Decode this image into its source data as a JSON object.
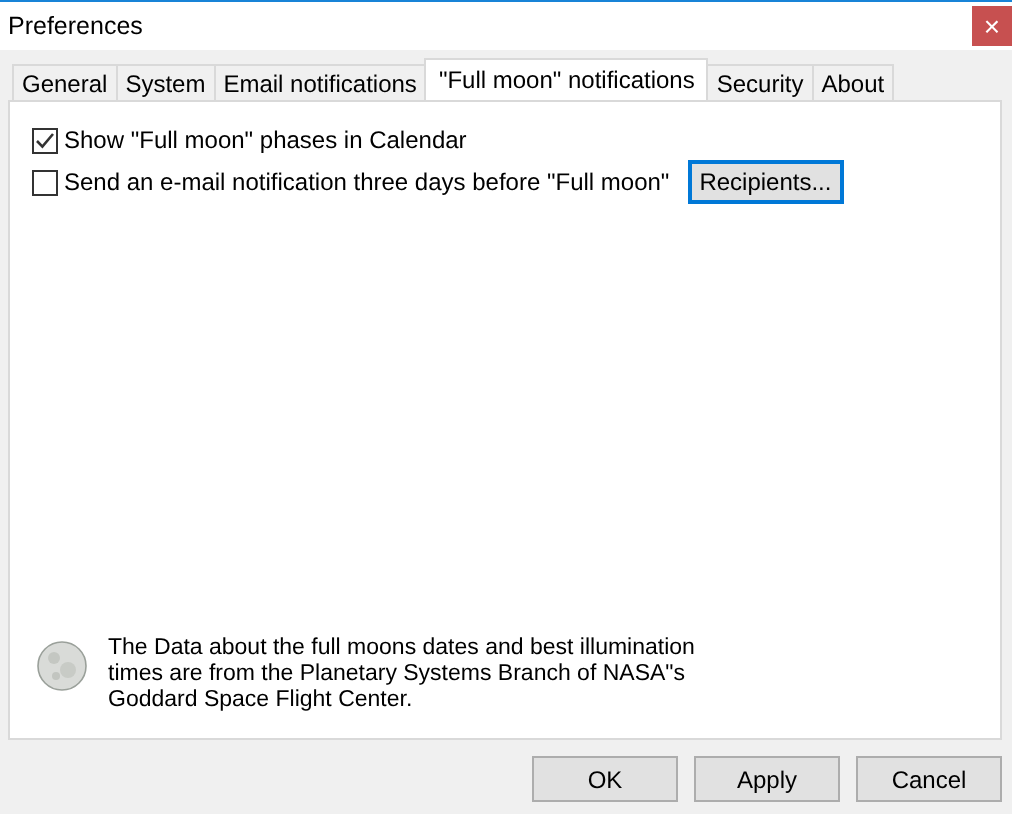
{
  "window": {
    "title": "Preferences",
    "close": "×"
  },
  "tabs": [
    {
      "label": "General",
      "selected": false
    },
    {
      "label": "System",
      "selected": false
    },
    {
      "label": "Email notifications",
      "selected": false
    },
    {
      "label": "\"Full moon\" notifications",
      "selected": true
    },
    {
      "label": "Security",
      "selected": false
    },
    {
      "label": "About",
      "selected": false
    }
  ],
  "options": [
    {
      "label": "Show \"Full moon\" phases in Calendar",
      "checked": true
    },
    {
      "label": "Send an e-mail notification three days before \"Full moon\"",
      "checked": false,
      "button": "Recipients..."
    }
  ],
  "info_lines": [
    "The Data about the full moons dates and best illumination",
    "times are from the Planetary Systems Branch of NASA\"s",
    "Goddard Space Flight Center."
  ],
  "buttons": [
    "OK",
    "Apply",
    "Cancel"
  ]
}
